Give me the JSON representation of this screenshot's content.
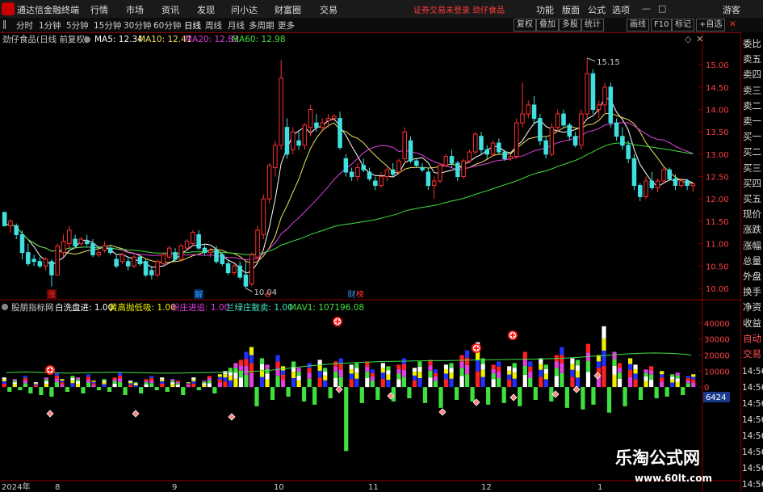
{
  "app": {
    "name": "通达信金融终端",
    "menu": [
      "行情",
      "市场",
      "资讯",
      "发现",
      "问小达",
      "财富圈",
      "交易"
    ],
    "notice": "证券交易未登录  劲仔食品",
    "right_menu": [
      "功能",
      "版面",
      "公式",
      "选项"
    ],
    "user": "游客",
    "window_controls": [
      "画线",
      "F10",
      "标记",
      "+自选"
    ]
  },
  "toolbar": {
    "periods": [
      "分时",
      "1分钟",
      "5分钟",
      "15分钟",
      "30分钟",
      "60分钟",
      "日线",
      "周线",
      "月线",
      "多周期",
      "更多"
    ],
    "active_period": "日线",
    "buttons": [
      "复权",
      "叠加",
      "多股",
      "统计"
    ]
  },
  "right_panel": {
    "labels": [
      "委比",
      "卖五",
      "卖四",
      "卖三",
      "卖二",
      "卖一",
      "买一",
      "买二",
      "买三",
      "买四",
      "买五",
      "现价",
      "涨跌",
      "涨幅",
      "总量",
      "外盘",
      "换手",
      "净资",
      "收益",
      "自动",
      "交易"
    ],
    "times": [
      "14:56",
      "14:56",
      "14:56",
      "14:56",
      "14:56",
      "14:56",
      "14:56",
      "14:56"
    ]
  },
  "main_chart": {
    "title": "劲仔食品(日线 前复权)",
    "ma_labels": [
      {
        "text": "MA5: 12.34",
        "color": "#ffffff"
      },
      {
        "text": "MA10: 12.41",
        "color": "#f0e060"
      },
      {
        "text": "MA20: 12.83",
        "color": "#e040e0"
      },
      {
        "text": "MA60: 12.98",
        "color": "#40e040"
      }
    ],
    "high_label": "15.15",
    "low_label": "10.04",
    "markers": [
      {
        "text": "涨",
        "color": "#ff3030",
        "bg": "#600000"
      },
      {
        "text": "解",
        "color": "#3aa0ff",
        "bg": "#002a60"
      },
      {
        "text": "8",
        "color": "#ff3030",
        "bg": ""
      },
      {
        "text": "财",
        "color": "#3aa0ff",
        "bg": ""
      },
      {
        "text": "榜",
        "color": "#ff3030",
        "bg": ""
      }
    ]
  },
  "indicator": {
    "name": "股朋指标网",
    "legend": [
      {
        "text": "白洗盘进: 1.00",
        "color": "#ffffff"
      },
      {
        "text": "黄高抛低吸: 1.00",
        "color": "#f0f000"
      },
      {
        "text": "粉庄进追: 1.00",
        "color": "#e040e0"
      },
      {
        "text": "兰绿庄散卖: 1.00",
        "color": "#40e0c0"
      },
      {
        "text": "MAV1: 107196.08",
        "color": "#40e040"
      }
    ],
    "current_badge": "6424"
  },
  "x_axis": {
    "labels": [
      "2024年",
      "8",
      "9",
      "10",
      "11",
      "12",
      "1"
    ]
  },
  "watermark": {
    "title": "乐淘公式网",
    "url": "www.60lt.com"
  },
  "chart_data": [
    {
      "type": "candlestick",
      "ylim": [
        9.8,
        15.4
      ],
      "ytick_labels": [
        "15.00",
        "14.50",
        "14.00",
        "13.50",
        "13.00",
        "12.50",
        "12.00",
        "11.50",
        "11.00",
        "10.50",
        "10.00"
      ],
      "ohlc": [
        [
          11.7,
          11.7,
          11.4,
          11.4
        ],
        [
          11.4,
          11.55,
          11.25,
          11.5
        ],
        [
          11.4,
          11.45,
          11.1,
          11.2
        ],
        [
          11.2,
          11.3,
          10.65,
          10.8
        ],
        [
          10.8,
          11.0,
          10.5,
          10.55
        ],
        [
          10.65,
          10.75,
          10.5,
          10.6
        ],
        [
          10.6,
          10.7,
          10.45,
          10.5
        ],
        [
          10.5,
          10.7,
          10.4,
          10.65
        ],
        [
          10.6,
          10.65,
          10.04,
          10.3
        ],
        [
          10.3,
          11.0,
          10.3,
          10.95
        ],
        [
          10.8,
          11.2,
          10.7,
          11.05
        ],
        [
          11.0,
          11.4,
          10.9,
          11.3
        ],
        [
          11.1,
          11.2,
          10.9,
          10.95
        ],
        [
          11.0,
          11.15,
          10.95,
          11.1
        ],
        [
          11.05,
          11.2,
          10.95,
          11.0
        ],
        [
          11.0,
          11.1,
          10.7,
          10.75
        ],
        [
          10.75,
          10.85,
          10.7,
          10.8
        ],
        [
          10.85,
          11.05,
          10.8,
          10.95
        ],
        [
          10.9,
          10.95,
          10.75,
          10.8
        ],
        [
          10.65,
          10.75,
          10.45,
          10.5
        ],
        [
          10.6,
          10.8,
          10.55,
          10.75
        ],
        [
          10.6,
          10.7,
          10.4,
          10.5
        ],
        [
          10.5,
          10.75,
          10.45,
          10.7
        ],
        [
          10.7,
          10.75,
          10.5,
          10.55
        ],
        [
          10.6,
          10.65,
          10.25,
          10.3
        ],
        [
          10.4,
          10.5,
          10.2,
          10.3
        ],
        [
          10.3,
          10.65,
          10.25,
          10.6
        ],
        [
          10.55,
          10.8,
          10.5,
          10.75
        ],
        [
          10.7,
          10.95,
          10.65,
          10.9
        ],
        [
          10.8,
          10.9,
          10.6,
          10.65
        ],
        [
          10.65,
          11.0,
          10.6,
          10.95
        ],
        [
          10.9,
          11.1,
          10.85,
          11.05
        ],
        [
          11.0,
          11.3,
          10.95,
          11.25
        ],
        [
          11.2,
          11.3,
          10.85,
          10.9
        ],
        [
          10.9,
          11.0,
          10.75,
          10.8
        ],
        [
          10.8,
          10.9,
          10.7,
          10.85
        ],
        [
          10.85,
          10.95,
          10.55,
          10.6
        ],
        [
          10.75,
          10.8,
          10.5,
          10.55
        ],
        [
          10.55,
          10.65,
          10.3,
          10.35
        ],
        [
          10.35,
          10.55,
          10.3,
          10.5
        ],
        [
          10.5,
          10.6,
          10.2,
          10.25
        ],
        [
          10.3,
          10.6,
          10.0,
          10.05
        ],
        [
          10.1,
          10.8,
          10.05,
          10.75
        ],
        [
          10.7,
          11.4,
          10.6,
          11.3
        ],
        [
          11.2,
          12.1,
          11.1,
          12.0
        ],
        [
          12.0,
          12.8,
          11.9,
          12.75
        ],
        [
          12.7,
          13.3,
          12.5,
          13.2
        ],
        [
          13.2,
          15.1,
          13.1,
          14.7
        ],
        [
          13.6,
          13.8,
          12.9,
          13.0
        ],
        [
          13.1,
          13.6,
          13.0,
          13.5
        ],
        [
          13.3,
          13.5,
          13.1,
          13.2
        ],
        [
          13.2,
          13.7,
          13.1,
          13.65
        ],
        [
          13.6,
          14.1,
          13.4,
          14.0
        ],
        [
          13.7,
          13.9,
          13.5,
          13.6
        ],
        [
          13.6,
          13.8,
          13.5,
          13.7
        ],
        [
          13.75,
          13.9,
          13.6,
          13.8
        ],
        [
          13.8,
          13.9,
          13.75,
          13.85
        ],
        [
          13.8,
          13.95,
          13.1,
          13.15
        ],
        [
          12.9,
          13.0,
          12.5,
          12.6
        ],
        [
          12.6,
          12.7,
          12.4,
          12.5
        ],
        [
          12.5,
          12.8,
          12.4,
          12.7
        ],
        [
          12.75,
          12.9,
          12.6,
          12.65
        ],
        [
          12.6,
          12.7,
          12.4,
          12.45
        ],
        [
          12.4,
          12.5,
          12.2,
          12.3
        ],
        [
          12.3,
          12.6,
          12.25,
          12.5
        ],
        [
          12.5,
          12.7,
          12.4,
          12.65
        ],
        [
          12.65,
          12.8,
          12.5,
          12.55
        ],
        [
          12.6,
          12.9,
          12.55,
          12.85
        ],
        [
          12.9,
          13.6,
          12.8,
          13.5
        ],
        [
          13.3,
          13.4,
          12.8,
          12.85
        ],
        [
          12.85,
          12.9,
          12.7,
          12.75
        ],
        [
          12.7,
          12.8,
          12.6,
          12.65
        ],
        [
          12.6,
          12.7,
          12.2,
          12.3
        ],
        [
          12.3,
          12.5,
          12.0,
          12.4
        ],
        [
          12.4,
          12.8,
          12.35,
          12.75
        ],
        [
          12.75,
          13.0,
          12.7,
          12.95
        ],
        [
          12.95,
          13.1,
          12.7,
          12.8
        ],
        [
          12.8,
          12.85,
          12.4,
          12.5
        ],
        [
          12.5,
          12.9,
          12.45,
          12.85
        ],
        [
          12.85,
          13.1,
          12.8,
          13.05
        ],
        [
          13.05,
          13.5,
          13.0,
          13.45
        ],
        [
          13.4,
          13.5,
          13.0,
          13.1
        ],
        [
          13.1,
          13.2,
          12.9,
          13.0
        ],
        [
          13.0,
          13.3,
          12.95,
          13.25
        ],
        [
          13.25,
          13.35,
          13.0,
          13.05
        ],
        [
          13.05,
          13.1,
          12.85,
          12.9
        ],
        [
          12.9,
          13.0,
          12.85,
          12.95
        ],
        [
          12.95,
          13.8,
          12.9,
          13.7
        ],
        [
          13.7,
          14.6,
          13.6,
          13.9
        ],
        [
          13.9,
          14.2,
          13.8,
          14.1
        ],
        [
          14.1,
          14.3,
          13.7,
          13.8
        ],
        [
          13.8,
          13.9,
          13.2,
          13.3
        ],
        [
          13.3,
          13.4,
          12.9,
          13.0
        ],
        [
          13.0,
          13.7,
          12.95,
          13.6
        ],
        [
          13.6,
          14.0,
          13.5,
          13.9
        ],
        [
          13.9,
          14.0,
          13.6,
          13.65
        ],
        [
          13.65,
          13.7,
          13.3,
          13.4
        ],
        [
          13.4,
          13.5,
          13.15,
          13.2
        ],
        [
          13.2,
          14.0,
          13.1,
          13.9
        ],
        [
          13.9,
          15.15,
          13.8,
          14.8
        ],
        [
          14.8,
          14.9,
          13.9,
          14.0
        ],
        [
          14.0,
          14.2,
          13.8,
          14.1
        ],
        [
          14.1,
          14.6,
          13.9,
          14.5
        ],
        [
          14.5,
          14.6,
          13.6,
          13.7
        ],
        [
          13.7,
          13.8,
          13.3,
          13.4
        ],
        [
          13.4,
          13.6,
          13.1,
          13.2
        ],
        [
          13.2,
          13.3,
          12.8,
          12.9
        ],
        [
          12.9,
          13.0,
          12.2,
          12.3
        ],
        [
          12.3,
          12.35,
          11.95,
          12.05
        ],
        [
          12.05,
          12.5,
          12.0,
          12.4
        ],
        [
          12.4,
          12.6,
          12.2,
          12.25
        ],
        [
          12.25,
          12.45,
          12.15,
          12.4
        ],
        [
          12.4,
          12.7,
          12.35,
          12.65
        ],
        [
          12.65,
          12.7,
          12.4,
          12.45
        ],
        [
          12.45,
          12.55,
          12.2,
          12.3
        ],
        [
          12.3,
          12.45,
          12.25,
          12.4
        ],
        [
          12.4,
          12.45,
          12.2,
          12.3
        ],
        [
          12.3,
          12.35,
          12.15,
          12.34
        ]
      ]
    },
    {
      "type": "bar",
      "ylim": [
        -55000,
        45000
      ],
      "ytick_labels": [
        "40000",
        "30000",
        "20000",
        "10000",
        "0"
      ],
      "values": [
        6000,
        -3000,
        5000,
        -2000,
        7000,
        -4000,
        3000,
        -5000,
        6000,
        -6000,
        9000,
        5000,
        -3000,
        7000,
        6000,
        -4000,
        8000,
        4000,
        -2000,
        5000,
        -3000,
        6000,
        9000,
        -5000,
        4000,
        3000,
        -4000,
        5000,
        7000,
        -2000,
        6000,
        -3000,
        5000,
        4000,
        -5000,
        3000,
        6000,
        -2000,
        4000,
        7000,
        -4000,
        8000,
        10000,
        12000,
        15000,
        17000,
        22000,
        25000,
        -12000,
        18000,
        14000,
        -8000,
        20000,
        13000,
        -6000,
        16000,
        12000,
        -9000,
        15000,
        -11000,
        17000,
        12000,
        -7000,
        16000,
        18000,
        -40000,
        14000,
        15000,
        -10000,
        16000,
        11000,
        -8000,
        15000,
        13000,
        -9000,
        14000,
        18000,
        -7000,
        12000,
        16000,
        -10000,
        17000,
        11000,
        -13000,
        14000,
        15000,
        -8000,
        20000,
        23000,
        -9000,
        28000,
        18000,
        -11000,
        14000,
        16000,
        -10000,
        13000,
        15000,
        -12000,
        22000,
        16000,
        -8000,
        18000,
        14000,
        -9000,
        20000,
        25000,
        -13000,
        18000,
        17000,
        -14000,
        27000,
        -11000,
        20000,
        38000,
        -16000,
        22000,
        15000,
        -12000,
        18000,
        14000,
        -8000,
        11000,
        13000,
        -7000,
        10000,
        -6000,
        8000,
        9000,
        -5000,
        7000,
        8000
      ],
      "mav_values": [
        9000,
        9200,
        9400,
        9300,
        9100,
        9000,
        8800,
        8700,
        8900,
        9000,
        9100,
        9200,
        9300,
        9100,
        9000,
        8900,
        8800,
        8700,
        8700,
        8800,
        8900,
        9000,
        9100,
        9200,
        9300,
        9400,
        9600,
        9900,
        10300,
        10800,
        11400,
        12100,
        12800,
        13400,
        13900,
        14400,
        14800,
        15100,
        15400,
        15600,
        15800,
        16000,
        16100,
        16200,
        16300,
        16400,
        16500,
        16500,
        16600,
        16700,
        16800,
        16900,
        17000,
        17100,
        17200,
        17300,
        17400,
        17500,
        17600,
        17800,
        18000,
        18300,
        18700,
        19100,
        19500,
        19900,
        20300,
        20700,
        21000,
        21200,
        21300,
        21200,
        21000,
        20600,
        20000
      ]
    }
  ]
}
